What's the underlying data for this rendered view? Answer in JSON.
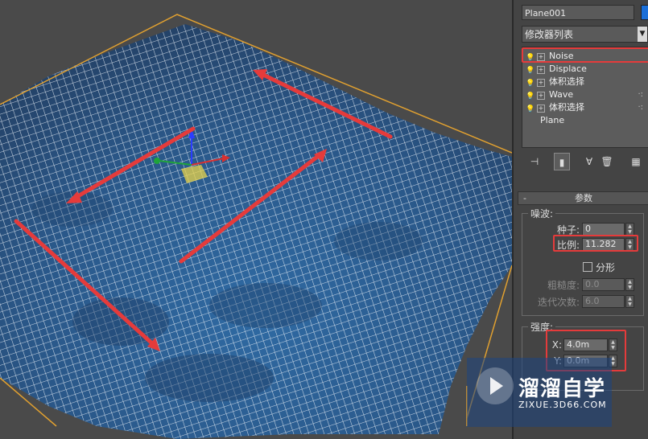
{
  "command_panel": {
    "object_name": "Plane001",
    "object_color": "#1b6fd8",
    "modifier_list": "修改器列表",
    "stack": [
      {
        "label": "Noise",
        "expandable": true,
        "highlighted": true
      },
      {
        "label": "Displace",
        "expandable": true
      },
      {
        "label": "体积选择",
        "expandable": true
      },
      {
        "label": "Wave",
        "expandable": true,
        "has_dots": true
      },
      {
        "label": "体积选择",
        "expandable": true,
        "has_dots": true
      },
      {
        "label": "Plane",
        "expandable": false
      }
    ],
    "toolbar_icons": [
      "pin-stack-icon",
      "show-end-result-icon",
      "make-unique-icon",
      "remove-modifier-icon",
      "configure-sets-icon"
    ]
  },
  "parameters": {
    "rollout_title": "参数",
    "noise_group": "噪波:",
    "seed_label": "种子:",
    "seed_value": "0",
    "scale_label": "比例:",
    "scale_value": "11.282",
    "fractal_label": "分形",
    "fractal_checked": false,
    "roughness_label": "粗糙度:",
    "roughness_value": "0.0",
    "iterations_label": "迭代次数:",
    "iterations_value": "6.0",
    "strength_group": "强度:",
    "x_label": "X:",
    "x_value": "4.0m",
    "y_label": "Y:",
    "y_value": "0.0m"
  },
  "watermark": {
    "title": "溜溜自学",
    "url": "ZIXUE.3D66.COM"
  },
  "colors": {
    "highlight_red": "#e53b3b",
    "mesh_blue": "#2b5c8f",
    "wire_white": "#e8eef5",
    "selection_orange": "#e0a030"
  }
}
